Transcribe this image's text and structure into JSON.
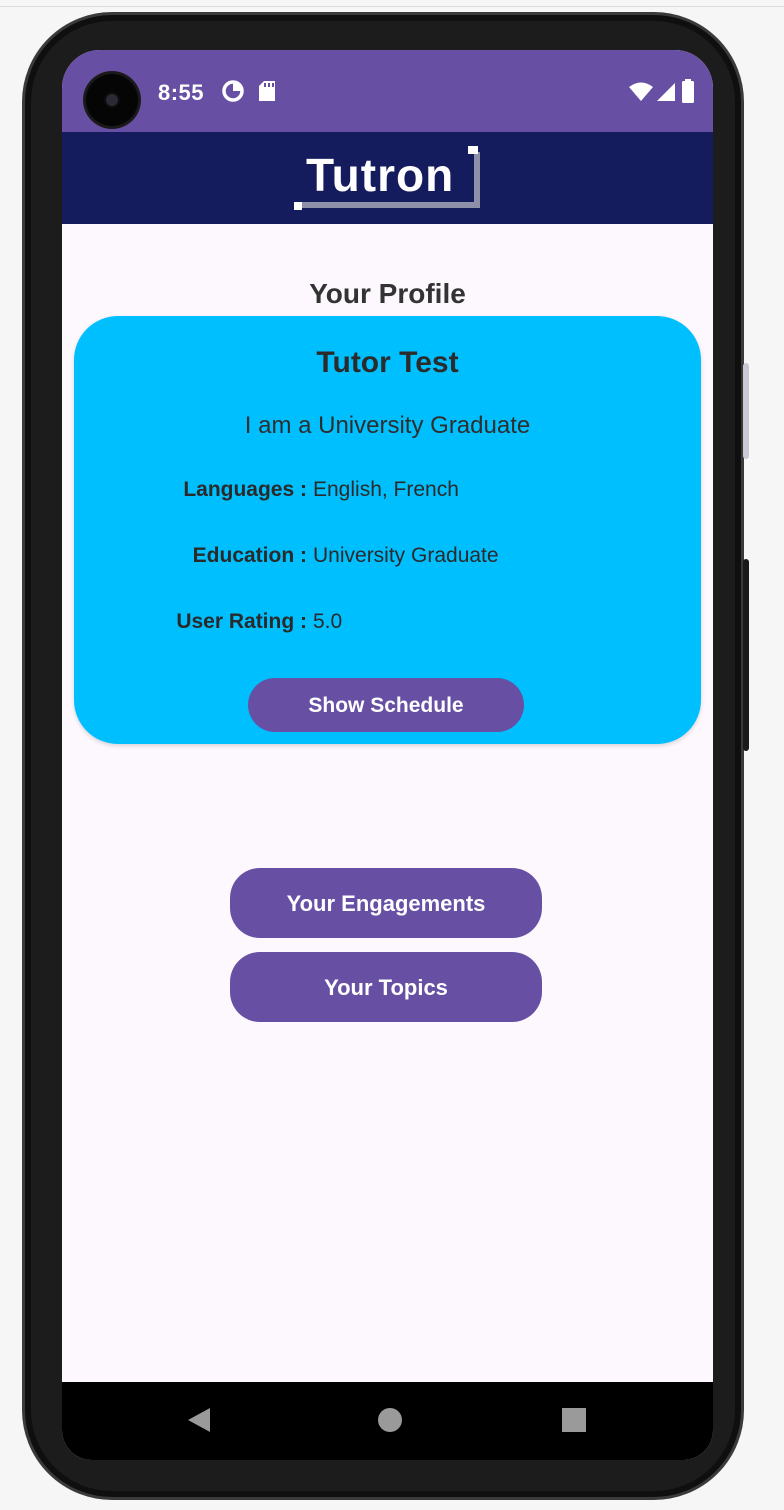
{
  "status_bar": {
    "time": "8:55",
    "icons": [
      "data-saver-icon",
      "sd-card-icon",
      "wifi-icon",
      "cell-signal-icon",
      "battery-icon"
    ]
  },
  "app_bar": {
    "logo_text": "Tutron"
  },
  "page": {
    "title": "Your Profile"
  },
  "profile_card": {
    "name": "Tutor Test",
    "tagline": "I am a University Graduate",
    "rows": [
      {
        "label": "Languages :",
        "value": "English, French"
      },
      {
        "label": "Education :",
        "value": "University Graduate"
      },
      {
        "label": "User Rating :",
        "value": "5.0"
      }
    ],
    "schedule_button": "Show Schedule"
  },
  "actions": {
    "engagements_button": "Your Engagements",
    "topics_button": "Your Topics"
  },
  "nav_bar": {
    "icons": [
      "back-icon",
      "home-icon",
      "recents-icon"
    ]
  },
  "colors": {
    "status_bar": "#6750a4",
    "app_bar": "#151c5e",
    "card": "#00bfff",
    "button": "#6750a4",
    "background": "#fdf8fd"
  }
}
